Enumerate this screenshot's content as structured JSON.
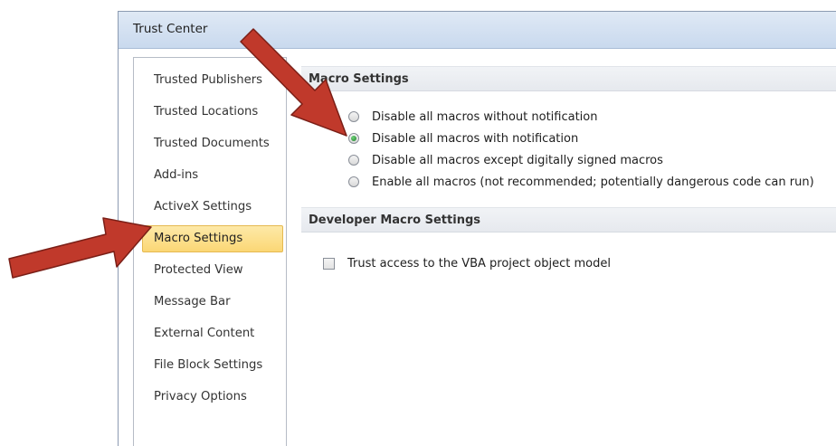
{
  "window": {
    "title": "Trust Center"
  },
  "sidebar": {
    "items": [
      {
        "label": "Trusted Publishers",
        "selected": false
      },
      {
        "label": "Trusted Locations",
        "selected": false
      },
      {
        "label": "Trusted Documents",
        "selected": false
      },
      {
        "label": "Add-ins",
        "selected": false
      },
      {
        "label": "ActiveX Settings",
        "selected": false
      },
      {
        "label": "Macro Settings",
        "selected": true
      },
      {
        "label": "Protected View",
        "selected": false
      },
      {
        "label": "Message Bar",
        "selected": false
      },
      {
        "label": "External Content",
        "selected": false
      },
      {
        "label": "File Block Settings",
        "selected": false
      },
      {
        "label": "Privacy Options",
        "selected": false
      }
    ]
  },
  "macro_settings": {
    "header": "Macro Settings",
    "options": [
      {
        "label": "Disable all macros without notification",
        "checked": false
      },
      {
        "label": "Disable all macros with notification",
        "checked": true
      },
      {
        "label": "Disable all macros except digitally signed macros",
        "checked": false
      },
      {
        "label": "Enable all macros (not recommended; potentially dangerous code can run)",
        "checked": false
      }
    ]
  },
  "developer_settings": {
    "header": "Developer Macro Settings",
    "vba_access": {
      "label": "Trust access to the VBA project object model",
      "checked": false
    }
  },
  "colors": {
    "annotation_arrow": "#c0392b",
    "selected_item": "#fbd775",
    "radio_checked": "#2e8b3a"
  }
}
